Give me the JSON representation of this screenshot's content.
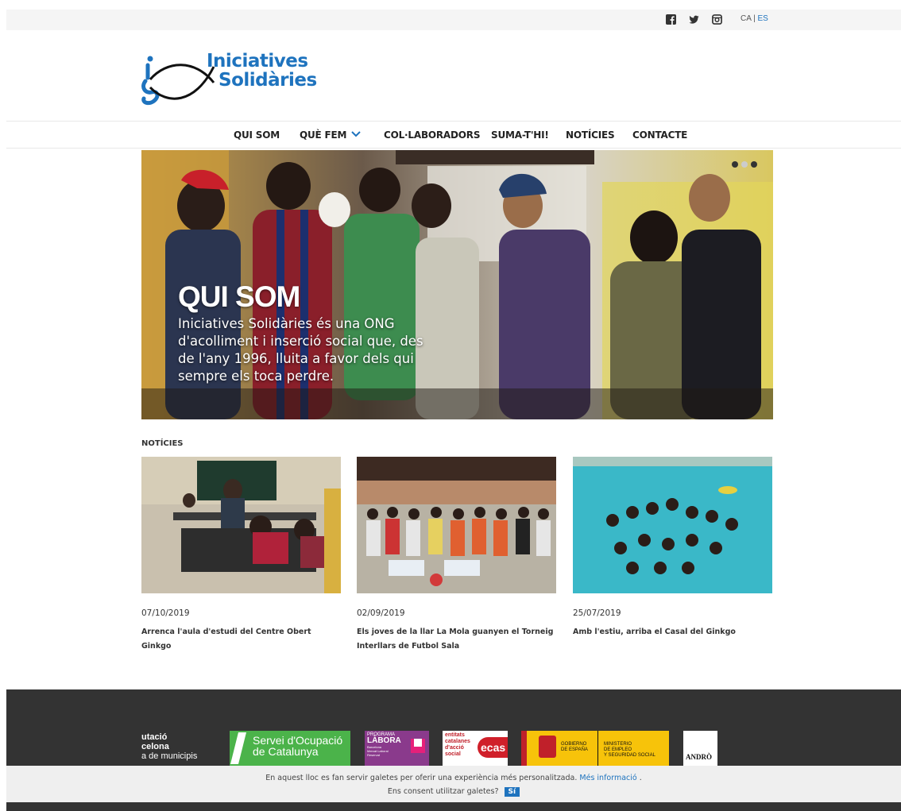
{
  "topbar": {
    "social": [
      "facebook-icon",
      "twitter-icon",
      "instagram-icon"
    ],
    "lang_ca": "CA",
    "lang_sep": " | ",
    "lang_es": "ES"
  },
  "logo": {
    "line1": "Iniciatives",
    "line2": "Solidàries"
  },
  "nav": {
    "items": [
      "QUI SOM",
      "QUÈ FEM",
      "COL·LABORADORS",
      "SUMA-T'HI!",
      "NOTÍCIES",
      "CONTACTE"
    ]
  },
  "hero": {
    "title": "QUI SOM",
    "text": "Iniciatives Solidàries és una ONG d'acolliment i inserció social que, des de l'any 1996, lluita a favor dels qui sempre els toca perdre.",
    "slides": 3,
    "active_slide": 3
  },
  "news": {
    "heading": "NOTÍCIES",
    "items": [
      {
        "date": "07/10/2019",
        "title": "Arrenca l'aula d'estudi del Centre Obert Ginkgo"
      },
      {
        "date": "02/09/2019",
        "title": "Els joves de la llar La Mola guanyen el Torneig Interllars de Futbol Sala"
      },
      {
        "date": "25/07/2019",
        "title": "Amb l'estiu, arriba el Casal del Ginkgo"
      }
    ]
  },
  "sponsors": {
    "diputacio": [
      "utació",
      "celona",
      "a de municipis"
    ],
    "soc": [
      "Servei d'Ocupació",
      "de Catalunya"
    ],
    "labora": [
      "PROGRAMA",
      "LÀBORA",
      "Barcelona",
      "Mercat Laboral",
      "Reservat"
    ],
    "ecas": [
      "entitats",
      "catalanes",
      "d'acció",
      "social",
      "ecas"
    ],
    "gobierno": [
      "GOBIERNO",
      "DE ESPAÑA"
    ],
    "ministerio": [
      "MINISTERIO",
      "DE EMPLEO",
      "Y SEGURIDAD SOCIAL"
    ],
    "andro": "ANDRÒ"
  },
  "cookie": {
    "line1": "En aquest lloc es fan servir galetes per oferir una experiència més personalitzada.",
    "more": "Més informació",
    "after_more": " .",
    "line2": "Ens consent utilitzar galetes?",
    "yes": "Sí"
  },
  "colors": {
    "brand_blue": "#1e73be",
    "footer": "#333333"
  }
}
